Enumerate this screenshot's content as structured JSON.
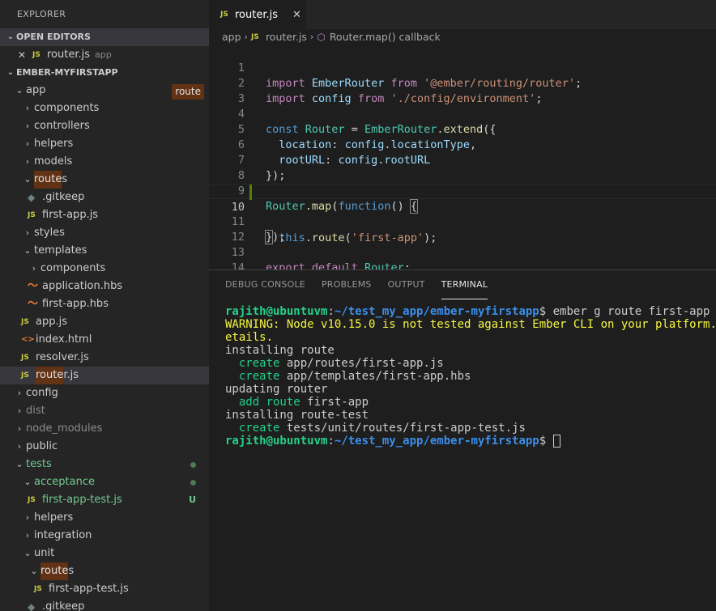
{
  "sidebar": {
    "title": "EXPLORER",
    "open_editors": {
      "header": "OPEN EDITORS",
      "items": [
        {
          "name": "router.js",
          "desc": "app"
        }
      ]
    },
    "project": {
      "header": "EMBER-MYFIRSTAPP",
      "items": [
        {
          "label": "app",
          "badge": "route"
        },
        {
          "label": "components"
        },
        {
          "label": "controllers"
        },
        {
          "label": "helpers"
        },
        {
          "label": "models"
        },
        {
          "label_hl": "route",
          "label_rest": "s"
        },
        {
          "label": ".gitkeep"
        },
        {
          "label": "first-app.js"
        },
        {
          "label": "styles"
        },
        {
          "label": "templates"
        },
        {
          "label": "components"
        },
        {
          "label": "application.hbs"
        },
        {
          "label": "first-app.hbs"
        },
        {
          "label": "app.js"
        },
        {
          "label": "index.html"
        },
        {
          "label": "resolver.js"
        },
        {
          "label_hl": "route",
          "label_rest": "r.js"
        },
        {
          "label": "config"
        },
        {
          "label": "dist"
        },
        {
          "label": "node_modules"
        },
        {
          "label": "public"
        },
        {
          "label": "tests"
        },
        {
          "label": "acceptance"
        },
        {
          "label": "first-app-test.js",
          "status": "U"
        },
        {
          "label": "helpers"
        },
        {
          "label": "integration"
        },
        {
          "label": "unit"
        },
        {
          "label_hl": "route",
          "label_rest": "s"
        },
        {
          "label": "first-app-test.js"
        },
        {
          "label": ".gitkeep"
        }
      ]
    }
  },
  "tab": {
    "label": "router.js",
    "icon": "JS"
  },
  "breadcrumb": {
    "folder": "app",
    "file": "router.js",
    "symbol": "Router.map() callback"
  },
  "code": {
    "line_numbers": [
      "1",
      "2",
      "3",
      "4",
      "5",
      "6",
      "7",
      "8",
      "9",
      "10",
      "11",
      "12",
      "13",
      "14"
    ],
    "l1": {
      "kw": "import",
      "id": "EmberRouter",
      "from": "from",
      "str": "'@ember/routing/router'",
      "end": ";"
    },
    "l2": {
      "kw": "import",
      "id": "config",
      "from": "from",
      "str": "'./config/environment'",
      "end": ";"
    },
    "l4": {
      "kw": "const",
      "id": "Router",
      "eq": " = ",
      "obj": "EmberRouter",
      "dot": ".",
      "fn": "extend",
      "end": "({"
    },
    "l5": {
      "prop": "location",
      "colon": ": ",
      "obj": "config",
      "dot": ".",
      "val": "locationType",
      "end": ","
    },
    "l6": {
      "prop": "rootURL",
      "colon": ": ",
      "obj": "config",
      "dot": ".",
      "val": "rootURL"
    },
    "l7": {
      "text": "});"
    },
    "l9": {
      "obj": "Router",
      "dot": ".",
      "fn": "map",
      "open": "(",
      "kw": "function",
      "args": "() ",
      "brace": "{"
    },
    "l10": {
      "kw": "this",
      "dot": ".",
      "fn": "route",
      "open": "(",
      "str": "'first-app'",
      "end": ");"
    },
    "l11": {
      "brace": "}",
      "end": ");"
    },
    "l13": {
      "kw1": "export",
      "kw2": "default",
      "id": "Router",
      "end": ";"
    }
  },
  "panel": {
    "tabs": [
      "DEBUG CONSOLE",
      "PROBLEMS",
      "OUTPUT",
      "TERMINAL"
    ],
    "active_tab": "TERMINAL",
    "terminal": {
      "user": "rajith@ubuntuvm",
      "sep": ":",
      "path": "~/test_my_app/ember-myfirstapp",
      "prompt": "$ ",
      "command": "ember g route first-app",
      "warning_1": "WARNING: Node v10.15.0 is not tested against Ember CLI on your platform. We",
      "warning_2": "etails.",
      "installing_route": "installing route",
      "create": "create",
      "created_1": " app/routes/first-app.js",
      "created_2": " app/templates/first-app.hbs",
      "updating_router": "updating router",
      "add_route": "add route",
      "add_route_target": " first-app",
      "installing_route_test": "installing route-test",
      "created_3": " tests/unit/routes/first-app-test.js"
    }
  }
}
